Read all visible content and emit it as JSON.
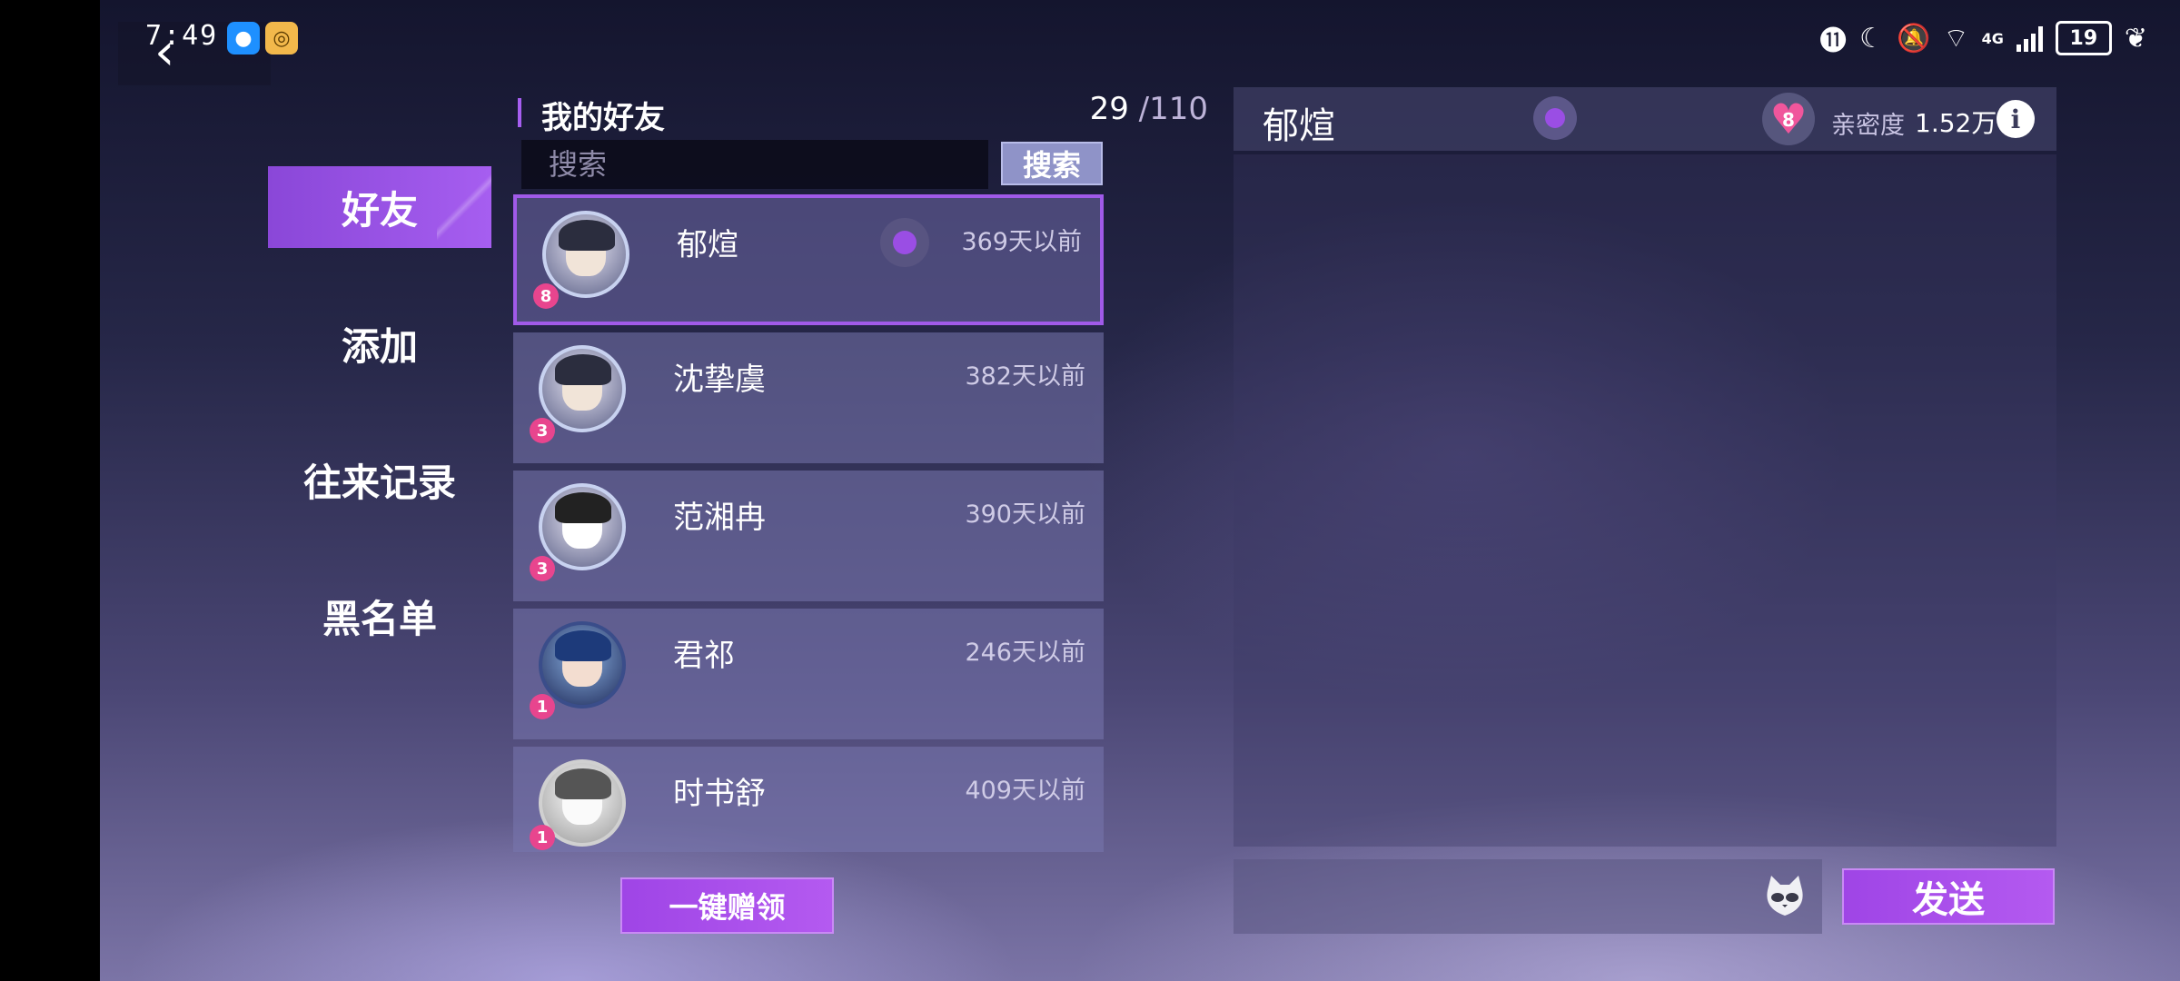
{
  "status_bar": {
    "time": "7:49",
    "battery": "19",
    "network": "4G"
  },
  "nav": {
    "items": [
      {
        "label": "好友",
        "active": true
      },
      {
        "label": "添加",
        "active": false
      },
      {
        "label": "往来记录",
        "active": false
      },
      {
        "label": "黑名单",
        "active": false
      }
    ]
  },
  "friends": {
    "title": "我的好友",
    "count": "29",
    "total": "/110",
    "search": {
      "placeholder": "搜索",
      "button": "搜索"
    },
    "list": [
      {
        "name": "郁煊",
        "time": "369天以前",
        "level": "8",
        "online": true
      },
      {
        "name": "沈挚虞",
        "time": "382天以前",
        "level": "3",
        "online": false
      },
      {
        "name": "范湘冉",
        "time": "390天以前",
        "level": "3",
        "online": false
      },
      {
        "name": "君祁",
        "time": "246天以前",
        "level": "1",
        "online": false
      },
      {
        "name": "时书舒",
        "time": "409天以前",
        "level": "1",
        "online": false
      }
    ],
    "gift_button": "一键赠领"
  },
  "chat": {
    "name": "郁煊",
    "heart_level": "8",
    "intimacy_label": "亲密度",
    "intimacy_value": "1.52万",
    "send_button": "发送"
  },
  "colors": {
    "accent": "#a65ef0",
    "heart": "#f0569c"
  }
}
